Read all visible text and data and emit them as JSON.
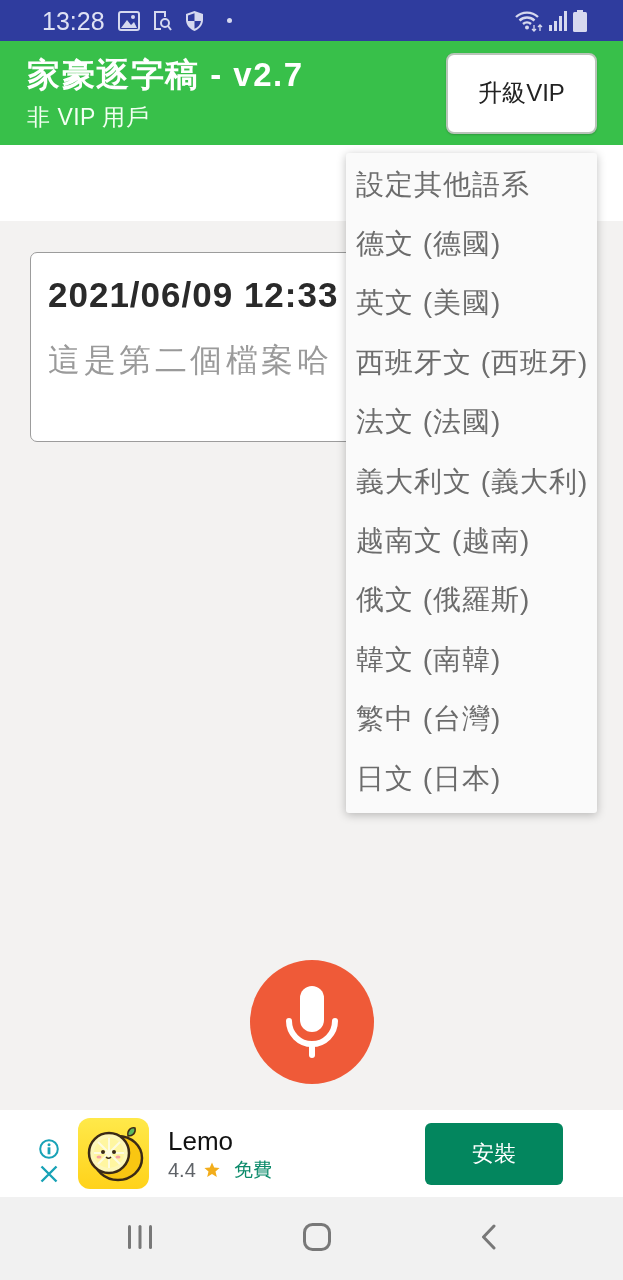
{
  "status_bar": {
    "time": "13:28"
  },
  "app_bar": {
    "title": "家豪逐字稿 - v2.7",
    "subtitle": "非 VIP 用戶",
    "upgrade_button": "升級VIP"
  },
  "recordings": [
    {
      "title": "2021/06/09 12:33",
      "preview": "這是第二個檔案哈"
    }
  ],
  "language_menu": {
    "items": [
      "設定其他語系",
      "德文 (德國)",
      "英文 (美國)",
      "西班牙文 (西班牙)",
      "法文 (法國)",
      "義大利文 (義大利)",
      "越南文 (越南)",
      "俄文 (俄羅斯)",
      "韓文 (南韓)",
      "繁中 (台灣)",
      "日文 (日本)"
    ]
  },
  "ad": {
    "app_name": "Lemo",
    "rating": "4.4",
    "price": "免費",
    "install_button": "安裝"
  }
}
